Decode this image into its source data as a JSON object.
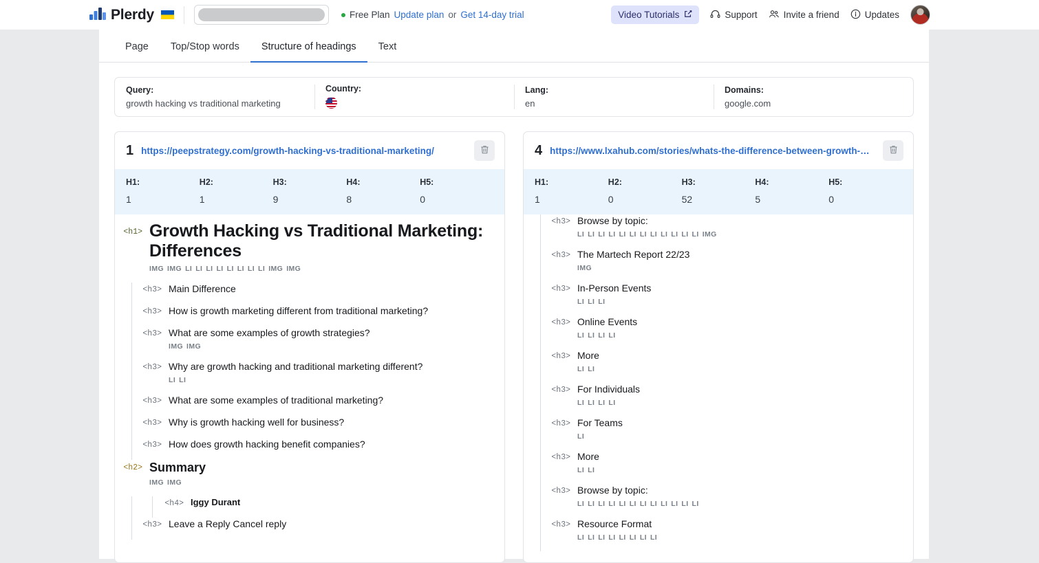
{
  "topbar": {
    "brand_name": "Plerdy",
    "brand_icon": "bar-chart-logo-icon",
    "flag_icon": "ukraine-flag-icon",
    "search_placeholder": "",
    "search_value": "",
    "plan_status": "Free Plan",
    "update_plan": "Update plan",
    "or": "or",
    "trial": "Get 14-day trial",
    "video_tutorials": "Video Tutorials",
    "support": "Support",
    "invite": "Invite a friend",
    "updates": "Updates"
  },
  "tabs": [
    {
      "label": "Page",
      "active": false
    },
    {
      "label": "Top/Stop words",
      "active": false
    },
    {
      "label": "Structure of headings",
      "active": true
    },
    {
      "label": "Text",
      "active": false
    }
  ],
  "meta": [
    {
      "label": "Query:",
      "value": "growth hacking vs traditional marketing",
      "icon": ""
    },
    {
      "label": "Country:",
      "value": "",
      "icon": "us-flag-icon"
    },
    {
      "label": "Lang:",
      "value": "en",
      "icon": ""
    },
    {
      "label": "Domains:",
      "value": "google.com",
      "icon": ""
    }
  ],
  "stat_labels": [
    "H1:",
    "H2:",
    "H3:",
    "H4:",
    "H5:"
  ],
  "cards": [
    {
      "rank": "1",
      "url": "https://peepstrategy.com/growth-hacking-vs-traditional-marketing/",
      "stats": [
        "1",
        "1",
        "9",
        "8",
        "0"
      ],
      "nodes": [
        {
          "tag": "<h1>",
          "level": "h1",
          "indent": 1,
          "title": "Growth Hacking vs Traditional Marketing: Differences",
          "chips": "IMG IMG LI LI LI LI LI LI LI LI IMG IMG"
        },
        {
          "tag": "<h3>",
          "level": "h3",
          "indent": 2,
          "title": "Main Difference",
          "chips": ""
        },
        {
          "tag": "<h3>",
          "level": "h3",
          "indent": 2,
          "title": "How is growth marketing different from traditional marketing?",
          "chips": ""
        },
        {
          "tag": "<h3>",
          "level": "h3",
          "indent": 2,
          "title": "What are some examples of growth strategies?",
          "chips": "IMG IMG"
        },
        {
          "tag": "<h3>",
          "level": "h3",
          "indent": 2,
          "title": "Why are growth hacking and traditional marketing different?",
          "chips": "LI LI"
        },
        {
          "tag": "<h3>",
          "level": "h3",
          "indent": 2,
          "title": "What are some examples of traditional marketing?",
          "chips": ""
        },
        {
          "tag": "<h3>",
          "level": "h3",
          "indent": 2,
          "title": "Why is growth hacking well for business?",
          "chips": ""
        },
        {
          "tag": "<h3>",
          "level": "h3",
          "indent": 2,
          "title": "How does growth hacking benefit companies?",
          "chips": ""
        },
        {
          "tag": "<h2>",
          "level": "h2",
          "indent": 1,
          "title": "Summary",
          "chips": "IMG IMG"
        },
        {
          "tag": "<h4>",
          "level": "h4",
          "indent": 3,
          "title": "Iggy Durant",
          "chips": ""
        },
        {
          "tag": "<h3>",
          "level": "h3",
          "indent": 2,
          "title": "Leave a Reply Cancel reply",
          "chips": ""
        }
      ]
    },
    {
      "rank": "4",
      "url": "https://www.lxahub.com/stories/whats-the-difference-between-growth-mar…",
      "stats": [
        "1",
        "0",
        "52",
        "5",
        "0"
      ],
      "nodes": [
        {
          "tag": "<h3>",
          "level": "h3",
          "indent": 2,
          "title": "Browse by topic:",
          "chips": "LI LI LI LI LI LI LI LI LI LI LI LI IMG"
        },
        {
          "tag": "<h3>",
          "level": "h3",
          "indent": 2,
          "title": "The Martech Report 22/23",
          "chips": "IMG"
        },
        {
          "tag": "<h3>",
          "level": "h3",
          "indent": 2,
          "title": "In-Person Events",
          "chips": "LI LI LI"
        },
        {
          "tag": "<h3>",
          "level": "h3",
          "indent": 2,
          "title": "Online Events",
          "chips": "LI LI LI LI"
        },
        {
          "tag": "<h3>",
          "level": "h3",
          "indent": 2,
          "title": "More",
          "chips": "LI LI"
        },
        {
          "tag": "<h3>",
          "level": "h3",
          "indent": 2,
          "title": "For Individuals",
          "chips": "LI LI LI LI"
        },
        {
          "tag": "<h3>",
          "level": "h3",
          "indent": 2,
          "title": "For Teams",
          "chips": "LI"
        },
        {
          "tag": "<h3>",
          "level": "h3",
          "indent": 2,
          "title": "More",
          "chips": "LI LI"
        },
        {
          "tag": "<h3>",
          "level": "h3",
          "indent": 2,
          "title": "Browse by topic:",
          "chips": "LI LI LI LI LI LI LI LI LI LI LI LI"
        },
        {
          "tag": "<h3>",
          "level": "h3",
          "indent": 2,
          "title": "Resource Format",
          "chips": "LI LI LI LI LI LI LI LI"
        }
      ]
    }
  ],
  "colors": {
    "accent": "#2f6fd0",
    "stats_bg": "#eaf4fd",
    "pill_bg": "#dfe2fb",
    "h1_tag": "#56662f",
    "h2_tag": "#9a7a1e",
    "h3_tag": "#6d737c",
    "page_bg": "#e9eaec"
  }
}
